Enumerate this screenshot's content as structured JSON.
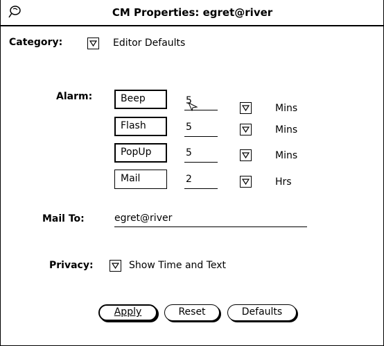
{
  "window": {
    "title": "CM Properties: egret@river"
  },
  "category": {
    "label": "Category:",
    "value": "Editor Defaults"
  },
  "alarm": {
    "label": "Alarm:",
    "rows": [
      {
        "setting": "Beep",
        "amount": "5",
        "unit": "Mins"
      },
      {
        "setting": "Flash",
        "amount": "5",
        "unit": "Mins"
      },
      {
        "setting": "PopUp",
        "amount": "5",
        "unit": "Mins"
      },
      {
        "setting": "Mail",
        "amount": "2",
        "unit": "Hrs"
      }
    ]
  },
  "mail_to": {
    "label": "Mail To:",
    "value": "egret@river"
  },
  "privacy": {
    "label": "Privacy:",
    "value": "Show Time and Text"
  },
  "buttons": {
    "apply": "Apply",
    "reset": "Reset",
    "defaults": "Defaults"
  }
}
